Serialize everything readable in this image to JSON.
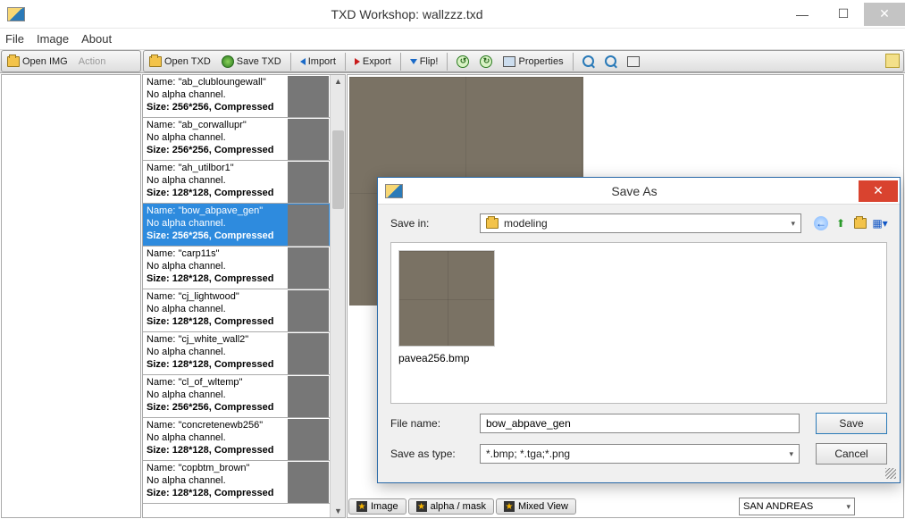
{
  "window": {
    "title": "TXD Workshop: wallzzz.txd"
  },
  "menu": {
    "file": "File",
    "image": "Image",
    "about": "About"
  },
  "toolbar_left": {
    "open_img": "Open IMG",
    "action": "Action"
  },
  "toolbar_right": {
    "open_txd": "Open TXD",
    "save_txd": "Save TXD",
    "import": "Import",
    "export": "Export",
    "flip": "Flip!",
    "properties": "Properties"
  },
  "textures": [
    {
      "name": "ab_clubloungewall",
      "alpha": "No alpha channel.",
      "size": "Size: 256*256, Compressed"
    },
    {
      "name": "ab_corwallupr",
      "alpha": "No alpha channel.",
      "size": "Size: 256*256, Compressed"
    },
    {
      "name": "ah_utilbor1",
      "alpha": "No alpha channel.",
      "size": "Size: 128*128, Compressed"
    },
    {
      "name": "bow_abpave_gen",
      "alpha": "No alpha channel.",
      "size": "Size: 256*256, Compressed"
    },
    {
      "name": "carp11s",
      "alpha": "No alpha channel.",
      "size": "Size: 128*128, Compressed"
    },
    {
      "name": "cj_lightwood",
      "alpha": "No alpha channel.",
      "size": "Size: 128*128, Compressed"
    },
    {
      "name": "cj_white_wall2",
      "alpha": "No alpha channel.",
      "size": "Size: 128*128, Compressed"
    },
    {
      "name": "cl_of_wltemp",
      "alpha": "No alpha channel.",
      "size": "Size: 256*256, Compressed"
    },
    {
      "name": "concretenewb256",
      "alpha": "No alpha channel.",
      "size": "Size: 128*128, Compressed"
    },
    {
      "name": "copbtm_brown",
      "alpha": "No alpha channel.",
      "size": "Size: 128*128, Compressed"
    }
  ],
  "name_prefix": "Name: \"",
  "name_suffix": "\"",
  "bottom": {
    "image": "Image",
    "alpha": "alpha / mask",
    "mixed": "Mixed View",
    "game": "SAN ANDREAS"
  },
  "dialog": {
    "title": "Save As",
    "save_in_label": "Save in:",
    "save_in_value": "modeling",
    "file_item": "pavea256.bmp",
    "filename_label": "File name:",
    "filename_value": "bow_abpave_gen",
    "type_label": "Save as type:",
    "type_value": "*.bmp; *.tga;*.png",
    "save_btn": "Save",
    "cancel_btn": "Cancel"
  }
}
